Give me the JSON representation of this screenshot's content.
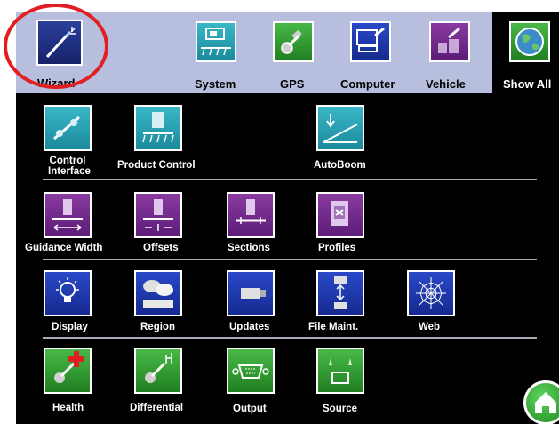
{
  "topbar": {
    "wizard": "Wizard",
    "system": "System",
    "gps": "GPS",
    "computer": "Computer",
    "vehicle": "Vehicle",
    "show_all": "Show All"
  },
  "row1": {
    "control_interface": "Control Interface",
    "product_control": "Product Control",
    "autoboom": "AutoBoom"
  },
  "row2": {
    "guidance_width": "Guidance Width",
    "offsets": "Offsets",
    "sections": "Sections",
    "profiles": "Profiles"
  },
  "row3": {
    "display": "Display",
    "region": "Region",
    "updates": "Updates",
    "file_maint": "File Maint.",
    "web": "Web"
  },
  "row4": {
    "health": "Health",
    "differential": "Differential",
    "output": "Output",
    "source": "Source"
  },
  "colors": {
    "highlight": "#e02020",
    "topbar": "#b8bedd"
  },
  "icons": {
    "home": "home-icon"
  }
}
